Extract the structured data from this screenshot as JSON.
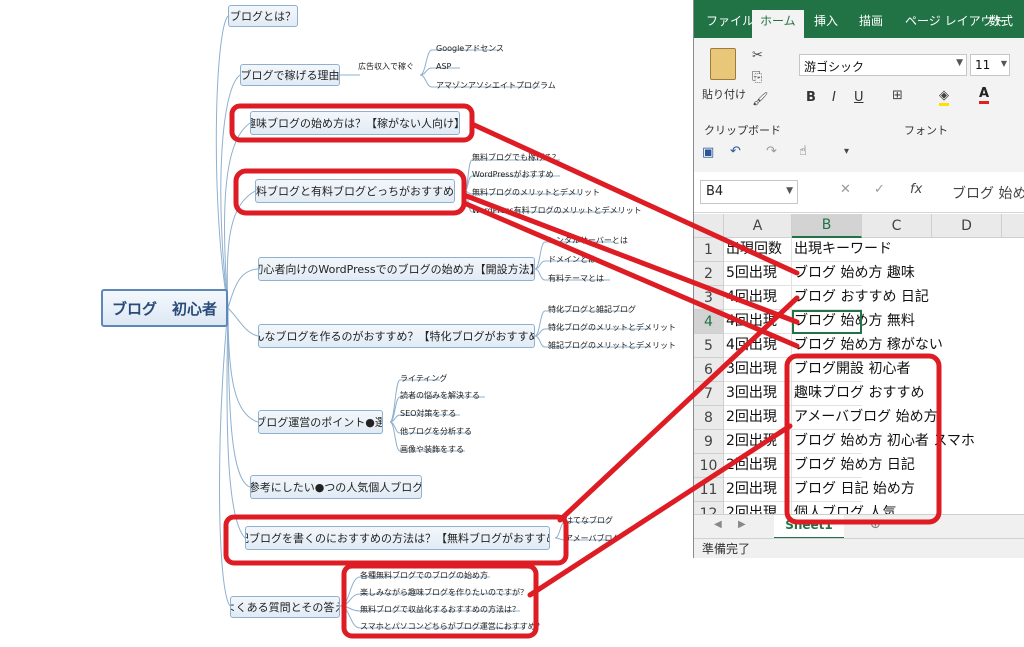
{
  "mindmap": {
    "root": "ブログ　初心者",
    "branches": [
      {
        "label": "ブログとは？"
      },
      {
        "label": "ブログで稼げる理由",
        "sub": "広告収入で稼ぐ",
        "leaves": [
          "Googleアドセンス",
          "ASP",
          "アマゾンアソシエイトプログラム"
        ]
      },
      {
        "label": "趣味ブログの始め方は？【稼がない人向け】"
      },
      {
        "label": "無料ブログと有料ブログどっちがおすすめ？",
        "leaves": [
          "無料ブログでも稼げる？",
          "WordPressがおすすめ",
          "無料ブログのメリットとデメリット",
          "WordPress有料ブログのメリットとデメリット"
        ]
      },
      {
        "label": "初心者向けのWordPressでのブログの始め方【開設方法】",
        "leaves": [
          "レンタルサーバーとは",
          "ドメインとは",
          "有料テーマとは"
        ]
      },
      {
        "label": "どんなブログを作るのがおすすめ？【特化ブログがおすすめ】",
        "leaves": [
          "特化ブログと雑記ブログ",
          "特化ブログのメリットとデメリット",
          "雑記ブログのメリットとデメリット"
        ]
      },
      {
        "label": "ブログ運営のポイント●選",
        "leaves": [
          "ライティング",
          "読者の悩みを解決する",
          "SEO対策をする",
          "他ブログを分析する",
          "画像や装飾をする"
        ]
      },
      {
        "label": "参考にしたい●つの人気個人ブログ"
      },
      {
        "label": "日記ブログを書くのにおすすめの方法は？【無料ブログがおすすめ】",
        "leaves": [
          "はてなブログ",
          "アメーバブログ"
        ]
      },
      {
        "label": "よくある質問とその答え",
        "leaves": [
          "各種無料ブログでのブログの始め方",
          "楽しみながら趣味ブログを作りたいのですが？",
          "無料ブログで収益化するおすすめの方法は？",
          "スマホとパソコンどちらがブログ運営におすすめ？"
        ]
      }
    ]
  },
  "excel": {
    "tabs": [
      "ファイル",
      "ホーム",
      "挿入",
      "描画",
      "ページ レイアウト",
      "数式"
    ],
    "active_tab": "ホーム",
    "paste_label": "貼り付け",
    "clipboard_label": "クリップボード",
    "font_group_label": "フォント",
    "font_name": "游ゴシック",
    "font_size": "11",
    "bold": "B",
    "italic": "I",
    "underline": "U",
    "name_box": "B4",
    "fx": "fx",
    "formula": "ブログ 始め",
    "columns": [
      "A",
      "B",
      "C",
      "D"
    ],
    "rows": [
      {
        "n": "1",
        "a": "出現回数",
        "b": "出現キーワード"
      },
      {
        "n": "2",
        "a": "5回出現",
        "b": "ブログ 始め方 趣味"
      },
      {
        "n": "3",
        "a": "4回出現",
        "b": "ブログ おすすめ 日記"
      },
      {
        "n": "4",
        "a": "4回出現",
        "b": "ブログ 始め方 無料"
      },
      {
        "n": "5",
        "a": "4回出現",
        "b": "ブログ 始め方 稼がない"
      },
      {
        "n": "6",
        "a": "3回出現",
        "b": "ブログ開設 初心者"
      },
      {
        "n": "7",
        "a": "3回出現",
        "b": "趣味ブログ おすすめ"
      },
      {
        "n": "8",
        "a": "2回出現",
        "b": "アメーバブログ 始め方"
      },
      {
        "n": "9",
        "a": "2回出現",
        "b": "ブログ 始め方 初心者 スマホ"
      },
      {
        "n": "10",
        "a": "2回出現",
        "b": "ブログ 始め方 日記"
      },
      {
        "n": "11",
        "a": "2回出現",
        "b": "ブログ 日記 始め方"
      },
      {
        "n": "12",
        "a": "2回出現",
        "b": "個人ブログ 人気"
      }
    ],
    "sheet_tab": "Sheet1",
    "status": "準備完了"
  },
  "colors": {
    "annotation": "#dd1c24",
    "excel_green": "#217346",
    "node_border": "#8fb0cf"
  }
}
